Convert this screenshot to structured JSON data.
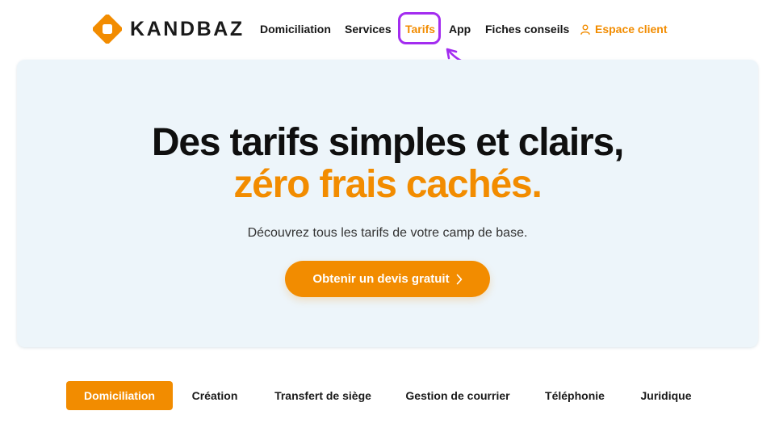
{
  "brand": {
    "name": "KANDBAZ",
    "color": "#f28c00"
  },
  "nav": {
    "items": [
      {
        "label": "Domiciliation"
      },
      {
        "label": "Services"
      },
      {
        "label": "Tarifs"
      },
      {
        "label": "App"
      },
      {
        "label": "Fiches conseils"
      }
    ],
    "active": "Tarifs",
    "client_label": "Espace client",
    "client_icon": "user-icon"
  },
  "annotation": {
    "color": "#a32cf0",
    "target": "Tarifs"
  },
  "hero": {
    "title_line1": "Des tarifs simples et clairs,",
    "title_line2": "zéro frais cachés.",
    "subtitle": "Découvrez tous les tarifs de votre camp de base.",
    "cta_label": "Obtenir un devis gratuit",
    "cta_icon": "chevron-right-icon"
  },
  "tabs": {
    "items": [
      {
        "label": "Domiciliation"
      },
      {
        "label": "Création"
      },
      {
        "label": "Transfert de siège"
      },
      {
        "label": "Gestion de courrier"
      },
      {
        "label": "Téléphonie"
      },
      {
        "label": "Juridique"
      }
    ],
    "active": "Domiciliation"
  }
}
